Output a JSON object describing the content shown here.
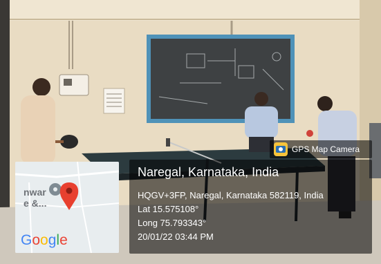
{
  "overlay": {
    "app_name": "GPS Map Camera",
    "app_icon": "gps-map-camera-icon",
    "location_title": "Naregal, Karnataka, India",
    "address": "HQGV+3FP, Naregal, Karnataka 582119, India",
    "latitude": "Lat 15.575108°",
    "longitude": "Long 75.793343°",
    "datetime": "20/01/22 03:44 PM"
  },
  "map": {
    "place_label_line1": "nwar",
    "place_label_line2": "e &...",
    "pin_icon": "map-pin-icon",
    "brand": [
      "G",
      "o",
      "o",
      "g",
      "l",
      "e"
    ],
    "pin_color": "#e8402f"
  },
  "scene": {
    "icons": [
      "ping-pong-paddle-icon",
      "blackboard-icon",
      "person-icon"
    ]
  }
}
